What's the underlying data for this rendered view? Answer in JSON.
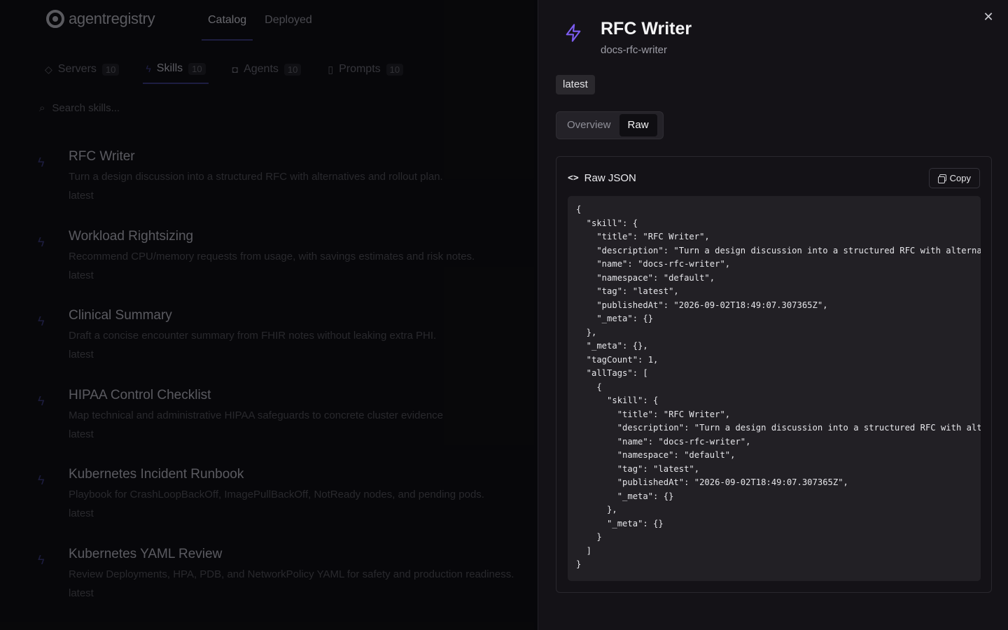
{
  "app": {
    "logo_text": "agentregistry",
    "nav": [
      "Catalog",
      "Deployed"
    ],
    "nav_active": "Catalog"
  },
  "resource_tabs": [
    {
      "label": "Servers",
      "count": "10",
      "icon": "server-icon"
    },
    {
      "label": "Skills",
      "count": "10",
      "icon": "bolt-icon"
    },
    {
      "label": "Agents",
      "count": "10",
      "icon": "bot-icon"
    },
    {
      "label": "Prompts",
      "count": "10",
      "icon": "document-icon"
    }
  ],
  "search": {
    "placeholder": "Search skills..."
  },
  "skills": [
    {
      "title": "RFC Writer",
      "description": "Turn a design discussion into a structured RFC with alternatives and rollout plan.",
      "tag": "latest"
    },
    {
      "title": "Workload Rightsizing",
      "description": "Recommend CPU/memory requests from usage, with savings estimates and risk notes.",
      "tag": "latest"
    },
    {
      "title": "Clinical Summary",
      "description": "Draft a concise encounter summary from FHIR notes without leaking extra PHI.",
      "tag": "latest"
    },
    {
      "title": "HIPAA Control Checklist",
      "description": "Map technical and administrative HIPAA safeguards to concrete cluster evidence",
      "tag": "latest"
    },
    {
      "title": "Kubernetes Incident Runbook",
      "description": "Playbook for CrashLoopBackOff, ImagePullBackOff, NotReady nodes, and pending pods.",
      "tag": "latest"
    },
    {
      "title": "Kubernetes YAML Review",
      "description": "Review Deployments, HPA, PDB, and NetworkPolicy YAML for safety and production readiness.",
      "tag": "latest"
    }
  ],
  "drawer": {
    "title": "RFC Writer",
    "subtitle": "docs-rfc-writer",
    "tag": "latest",
    "tabs": [
      "Overview",
      "Raw"
    ],
    "active_tab": "Raw",
    "raw_heading": "Raw JSON",
    "copy_label": "Copy",
    "accent_color": "#7c5cf0",
    "json_text": "{\n  \"skill\": {\n    \"title\": \"RFC Writer\",\n    \"description\": \"Turn a design discussion into a structured RFC with alternat\n    \"name\": \"docs-rfc-writer\",\n    \"namespace\": \"default\",\n    \"tag\": \"latest\",\n    \"publishedAt\": \"2026-09-02T18:49:07.307365Z\",\n    \"_meta\": {}\n  },\n  \"_meta\": {},\n  \"tagCount\": 1,\n  \"allTags\": [\n    {\n      \"skill\": {\n        \"title\": \"RFC Writer\",\n        \"description\": \"Turn a design discussion into a structured RFC with alte\n        \"name\": \"docs-rfc-writer\",\n        \"namespace\": \"default\",\n        \"tag\": \"latest\",\n        \"publishedAt\": \"2026-09-02T18:49:07.307365Z\",\n        \"_meta\": {}\n      },\n      \"_meta\": {}\n    }\n  ]\n}"
  }
}
